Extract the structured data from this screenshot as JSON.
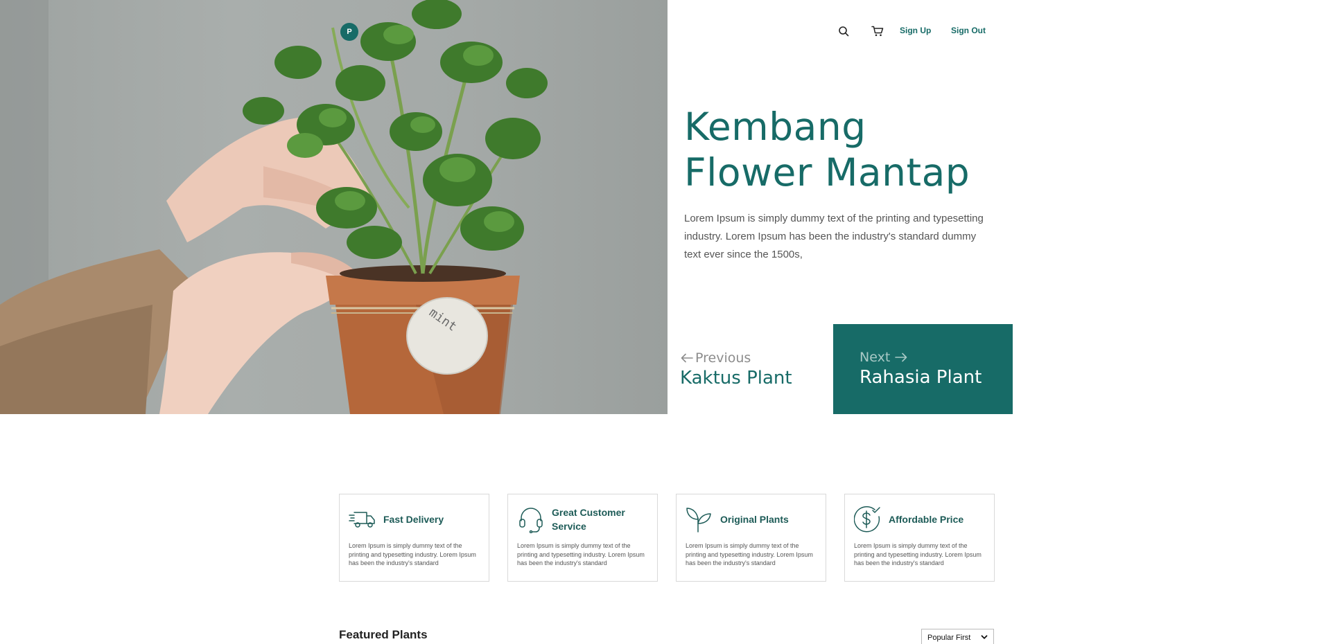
{
  "header": {
    "logo_letter": "P",
    "nav": {
      "signup_label": "Sign Up",
      "signout_label": "Sign Out"
    },
    "icons": [
      "search-icon",
      "cart-icon"
    ]
  },
  "hero": {
    "title_line1": "Kembang",
    "title_line2": "Flower Mantap",
    "description": "Lorem Ipsum is simply dummy text of the printing and typesetting industry. Lorem Ipsum has been the industry's standard dummy text ever since the 1500s,",
    "image_tag_text": "mint",
    "prev": {
      "kicker": "Previous",
      "plant": "Kaktus Plant"
    },
    "next": {
      "kicker": "Next",
      "plant": "Rahasia Plant"
    }
  },
  "features": [
    {
      "icon": "truck-icon",
      "title": "Fast Delivery",
      "description": "Lorem Ipsum is simply dummy text of the printing and typesetting industry. Lorem Ipsum has been the industry's standard"
    },
    {
      "icon": "headset-icon",
      "title": "Great Customer Service",
      "description": "Lorem Ipsum is simply dummy text of the printing and typesetting industry. Lorem Ipsum has been the industry's standard"
    },
    {
      "icon": "sprout-icon",
      "title": "Original Plants",
      "description": "Lorem Ipsum is simply dummy text of the printing and typesetting industry. Lorem Ipsum has been the industry's standard"
    },
    {
      "icon": "dollar-check-icon",
      "title": "Affordable Price",
      "description": "Lorem Ipsum is simply dummy text of the printing and typesetting industry. Lorem Ipsum has been the industry's standard"
    }
  ],
  "featured": {
    "title": "Featured Plants",
    "sort_selected": "Popular First"
  },
  "colors": {
    "brand": "#176b67",
    "text_muted": "#555555",
    "next_kicker": "#a9c9c6"
  }
}
